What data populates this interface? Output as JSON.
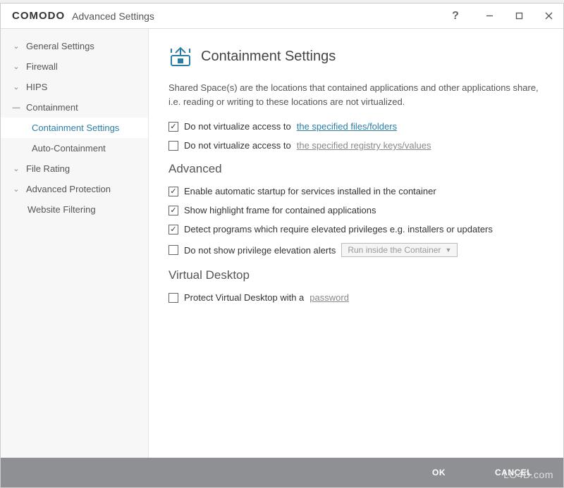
{
  "window": {
    "logo": "COMODO",
    "title": "Advanced Settings"
  },
  "sidebar": {
    "items": [
      {
        "label": "General Settings",
        "expanded": false
      },
      {
        "label": "Firewall",
        "expanded": false
      },
      {
        "label": "HIPS",
        "expanded": false
      },
      {
        "label": "Containment",
        "expanded": true,
        "children": [
          {
            "label": "Containment Settings",
            "selected": true
          },
          {
            "label": "Auto-Containment",
            "selected": false
          }
        ]
      },
      {
        "label": "File Rating",
        "expanded": false
      },
      {
        "label": "Advanced Protection",
        "expanded": false
      },
      {
        "label": "Website Filtering",
        "no_chev": true
      }
    ]
  },
  "page": {
    "title": "Containment Settings",
    "description": "Shared Space(s) are the locations that contained applications and other applications share, i.e. reading or writing to these locations are not virtualized.",
    "row1": {
      "checked": true,
      "label": "Do not virtualize access to",
      "link": "the specified files/folders"
    },
    "row2": {
      "checked": false,
      "label": "Do not virtualize access to",
      "link": "the specified registry keys/values"
    },
    "section_advanced": "Advanced",
    "adv1": {
      "checked": true,
      "label": "Enable automatic startup for services installed in the container"
    },
    "adv2": {
      "checked": true,
      "label": "Show highlight frame for contained applications"
    },
    "adv3": {
      "checked": true,
      "label": "Detect programs which require elevated privileges e.g. installers or updaters"
    },
    "adv4": {
      "checked": false,
      "label": "Do not show privilege elevation alerts",
      "dropdown": "Run inside the Container"
    },
    "section_vd": "Virtual Desktop",
    "vd1": {
      "checked": false,
      "label": "Protect Virtual Desktop with a",
      "link": "password"
    }
  },
  "buttons": {
    "ok": "OK",
    "cancel": "CANCEL"
  },
  "watermark": "LO4D.com"
}
